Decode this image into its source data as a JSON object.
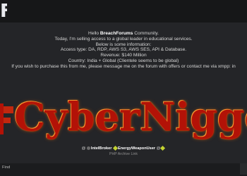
{
  "header": {
    "logo_tail": "F"
  },
  "post": {
    "lines": [
      {
        "pre": "Hello ",
        "brand": "BreachForums",
        "post": " Community."
      },
      "Today, I'm selling access to a global leader in educational services.",
      "Below is some information:",
      "Access type: DA, RDP, AWS S3, AWS SES, API & Database.",
      "Revenue: $140 Million",
      "Country: India + Global (Clientele seems to be global)",
      "If you wish to purchase this from me, please message me on the forum with offers or contact me via xmpp: in"
    ]
  },
  "banner": {
    "text": "CyberNigge"
  },
  "signature": {
    "prefix": "@",
    "user1": "",
    "user2": "IntelBroker",
    "user3": "EnergyWeaponUser",
    "user4": "@",
    "user5": "",
    "link": "PHP Archive Link"
  },
  "footer": {
    "find_label": "Find"
  },
  "colors": {
    "banner_red": "#b31207",
    "banner_glow": "#ff7a1a",
    "background": "#242528",
    "topbar": "#161718"
  }
}
